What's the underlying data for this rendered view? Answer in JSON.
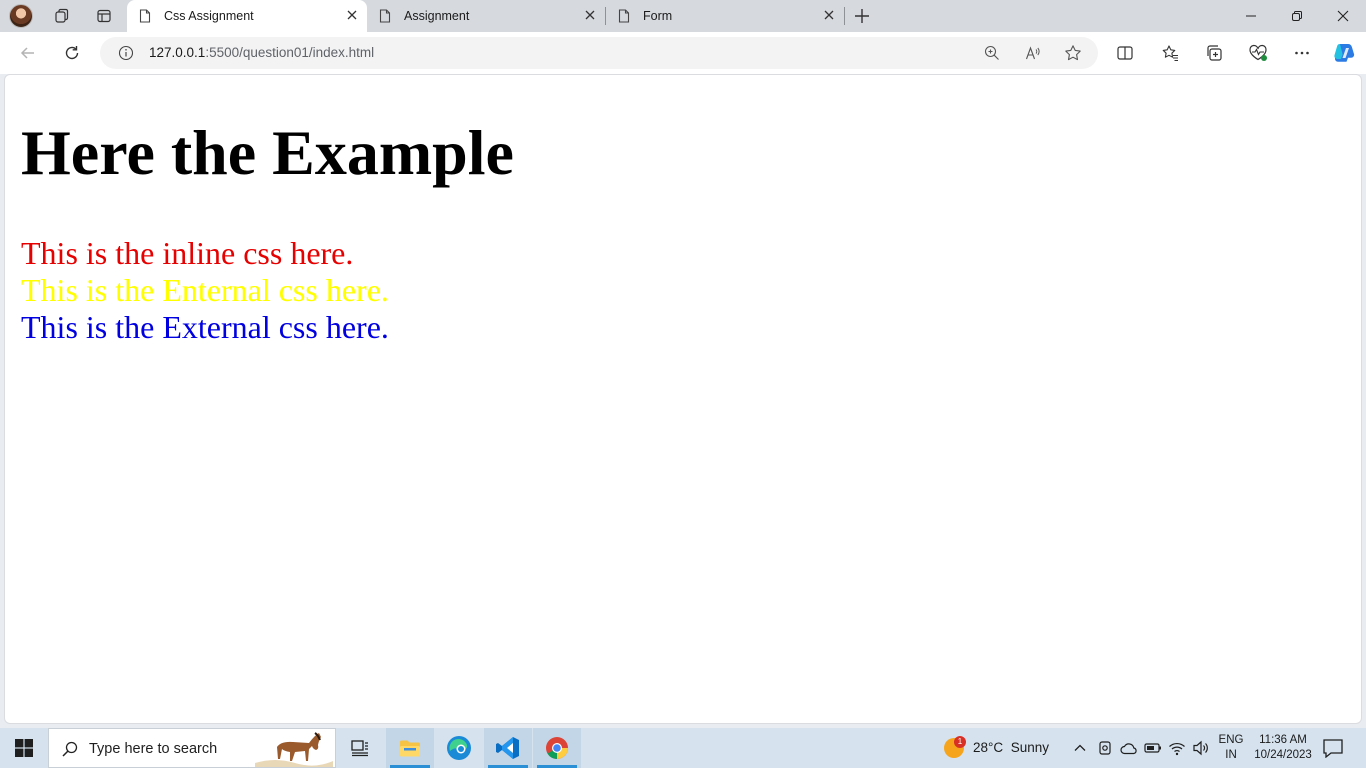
{
  "browser": {
    "tabs": [
      {
        "title": "Css Assignment",
        "active": true
      },
      {
        "title": "Assignment",
        "active": false
      },
      {
        "title": "Form",
        "active": false
      }
    ],
    "address": {
      "host": "127.0.0.1",
      "path": ":5500/question01/index.html"
    }
  },
  "page": {
    "heading": "Here the Example",
    "paragraphs": [
      {
        "text": "This is the inline css here.",
        "color": "#e60000"
      },
      {
        "text": "This is the Enternal css here.",
        "color": "#ffff00"
      },
      {
        "text": "This is the External css here.",
        "color": "#0000e0"
      }
    ]
  },
  "taskbar": {
    "search_placeholder": "Type here to search",
    "weather": {
      "temp": "28°C",
      "condition": "Sunny",
      "badge": "1"
    },
    "language": {
      "line1": "ENG",
      "line2": "IN"
    },
    "clock": {
      "time": "11:36 AM",
      "date": "10/24/2023"
    },
    "pinned": [
      "task-view",
      "file-explorer",
      "edge",
      "vscode",
      "chrome"
    ]
  },
  "colors": {
    "accent": "#2b8fd6",
    "tabstrip": "#d6d9de",
    "taskbar": "#d6e3ef"
  }
}
